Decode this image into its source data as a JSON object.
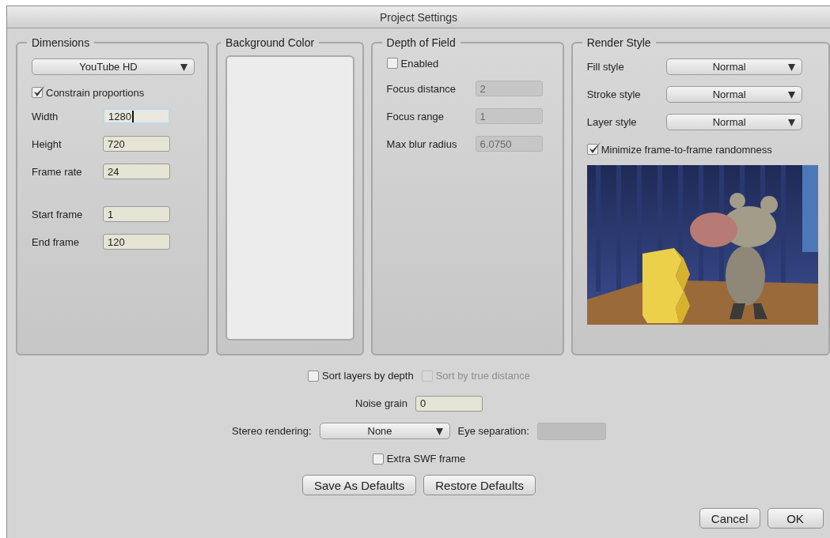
{
  "window": {
    "title": "Project Settings"
  },
  "dimensions": {
    "title": "Dimensions",
    "preset": "YouTube HD",
    "constrain": {
      "label": "Constrain proportions",
      "checked": true
    },
    "fields": [
      {
        "label": "Width",
        "value": "1280",
        "focused": true
      },
      {
        "label": "Height",
        "value": "720",
        "focused": false
      },
      {
        "label": "Frame rate",
        "value": "24",
        "focused": false
      }
    ],
    "frame_fields": [
      {
        "label": "Start frame",
        "value": "1",
        "focused": false
      },
      {
        "label": "End frame",
        "value": "120",
        "focused": false
      }
    ]
  },
  "background_color": {
    "title": "Background Color"
  },
  "depth_of_field": {
    "title": "Depth of Field",
    "enabled": {
      "label": "Enabled",
      "checked": false
    },
    "fields": [
      {
        "label": "Focus distance",
        "value": "2",
        "disabled": true
      },
      {
        "label": "Focus range",
        "value": "1",
        "disabled": true
      },
      {
        "label": "Max blur radius",
        "value": "6.0750",
        "disabled": true
      }
    ]
  },
  "render_style": {
    "title": "Render Style",
    "dropdowns": [
      {
        "label": "Fill style",
        "value": "Normal"
      },
      {
        "label": "Stroke style",
        "value": "Normal"
      },
      {
        "label": "Layer style",
        "value": "Normal"
      }
    ],
    "minimize": {
      "label": "Minimize frame-to-frame randomness",
      "checked": true
    }
  },
  "sort_layers": {
    "label": "Sort layers by depth",
    "checked": false,
    "disabled": false
  },
  "sort_true_distance": {
    "label": "Sort by true distance",
    "checked": false,
    "disabled": true
  },
  "noise_grain": {
    "label": "Noise grain",
    "value": "0"
  },
  "stereo": {
    "label": "Stereo rendering:",
    "value": "None"
  },
  "eye_separation": {
    "label": "Eye separation:",
    "disabled": true
  },
  "extra_swf": {
    "label": "Extra SWF frame",
    "checked": false,
    "disabled": false
  },
  "default_buttons": [
    "Save As Defaults",
    "Restore Defaults"
  ],
  "dialog_buttons": [
    "Cancel",
    "OK"
  ]
}
